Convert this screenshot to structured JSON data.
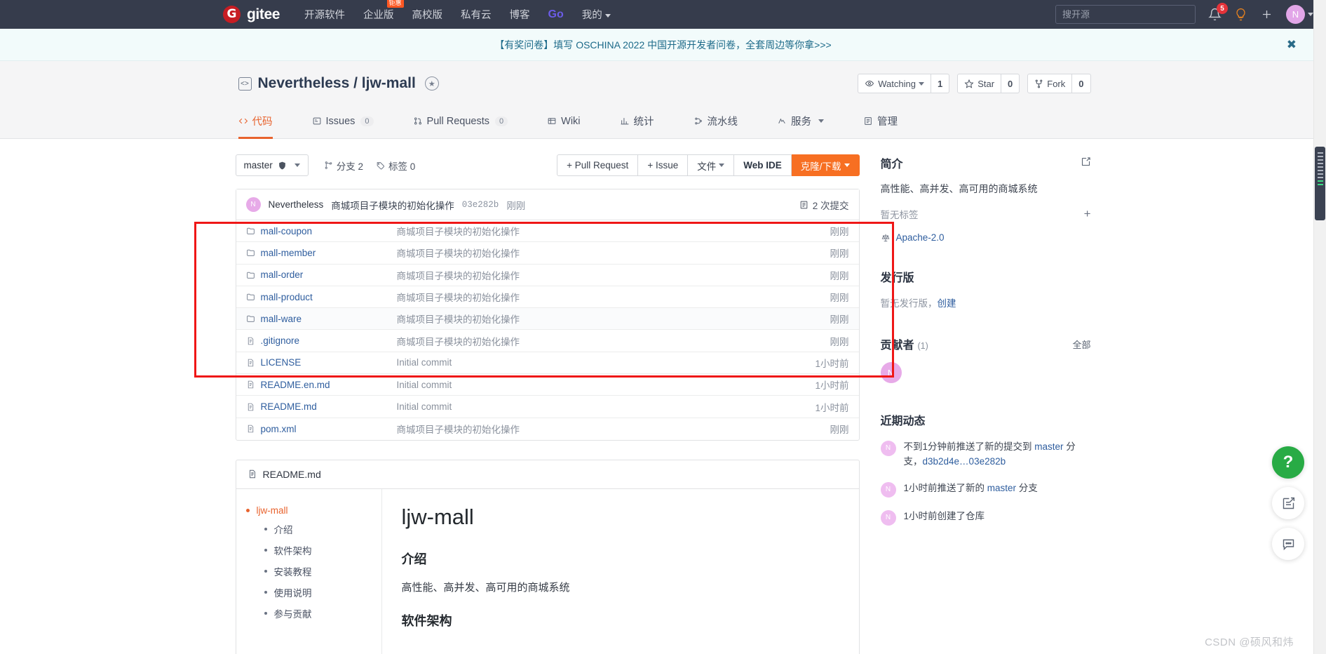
{
  "topnav": {
    "logo_text": "gitee",
    "logo_glyph": "G",
    "items": [
      {
        "label": "开源软件",
        "badge": ""
      },
      {
        "label": "企业版",
        "badge": "钜惠"
      },
      {
        "label": "高校版",
        "badge": ""
      },
      {
        "label": "私有云",
        "badge": ""
      },
      {
        "label": "博客",
        "badge": ""
      },
      {
        "label": "Go",
        "badge": ""
      },
      {
        "label": "我的",
        "badge": ""
      }
    ],
    "search_placeholder": "搜开源",
    "notification_count": "5",
    "avatar_letter": "N"
  },
  "banner": {
    "text": "【有奖问卷】填写 OSCHINA 2022 中国开源开发者问卷，全套周边等你拿>>>",
    "close_glyph": "✖"
  },
  "repo": {
    "owner": "Nevertheless",
    "separator": "/",
    "name": "ljw-mall",
    "watch_label": "Watching",
    "watch_count": "1",
    "star_label": "Star",
    "star_count": "0",
    "fork_label": "Fork",
    "fork_count": "0"
  },
  "tabs": [
    {
      "label": "代码",
      "count": "",
      "active": true
    },
    {
      "label": "Issues",
      "count": "0",
      "active": false
    },
    {
      "label": "Pull Requests",
      "count": "0",
      "active": false
    },
    {
      "label": "Wiki",
      "count": "",
      "active": false
    },
    {
      "label": "统计",
      "count": "",
      "active": false
    },
    {
      "label": "流水线",
      "count": "",
      "active": false
    },
    {
      "label": "服务",
      "count": "",
      "active": false
    },
    {
      "label": "管理",
      "count": "",
      "active": false
    }
  ],
  "toolbar": {
    "branch": "master",
    "branches_label": "分支 2",
    "tags_label": "标签 0",
    "pull_request_label": "+ Pull Request",
    "issue_label": "+ Issue",
    "files_label": "文件",
    "webide_label": "Web IDE",
    "clone_label": "克隆/下载"
  },
  "commit_bar": {
    "avatar_letter": "N",
    "author": "Nevertheless",
    "message": "商城项目子模块的初始化操作",
    "sha": "03e282b",
    "time": "刚刚",
    "commit_count": "2 次提交"
  },
  "files": [
    {
      "name": "mall-coupon",
      "type": "dir",
      "message": "商城项目子模块的初始化操作",
      "time": "刚刚"
    },
    {
      "name": "mall-member",
      "type": "dir",
      "message": "商城项目子模块的初始化操作",
      "time": "刚刚"
    },
    {
      "name": "mall-order",
      "type": "dir",
      "message": "商城项目子模块的初始化操作",
      "time": "刚刚"
    },
    {
      "name": "mall-product",
      "type": "dir",
      "message": "商城项目子模块的初始化操作",
      "time": "刚刚"
    },
    {
      "name": "mall-ware",
      "type": "dir",
      "message": "商城项目子模块的初始化操作",
      "time": "刚刚"
    },
    {
      "name": ".gitignore",
      "type": "file",
      "message": "商城项目子模块的初始化操作",
      "time": "刚刚"
    },
    {
      "name": "LICENSE",
      "type": "file",
      "message": "Initial commit",
      "time": "1小时前"
    },
    {
      "name": "README.en.md",
      "type": "file",
      "message": "Initial commit",
      "time": "1小时前"
    },
    {
      "name": "README.md",
      "type": "file",
      "message": "Initial commit",
      "time": "1小时前"
    },
    {
      "name": "pom.xml",
      "type": "file",
      "message": "商城项目子模块的初始化操作",
      "time": "刚刚"
    }
  ],
  "readme": {
    "filename": "README.md",
    "toc": [
      "ljw-mall",
      "介绍",
      "软件架构",
      "安装教程",
      "使用说明",
      "参与贡献"
    ],
    "h1": "ljw-mall",
    "section1_title": "介绍",
    "section1_text": "高性能、高并发、高可用的商城系统",
    "section2_title": "软件架构"
  },
  "sidebar": {
    "intro_title": "简介",
    "intro_text": "高性能、高并发、高可用的商城系统",
    "no_tags": "暂无标签",
    "license": "Apache-2.0",
    "releases_title": "发行版",
    "no_releases": "暂无发行版，",
    "create_link": "创建",
    "contributors_title": "贡献者",
    "contributors_count": "(1)",
    "contributors_all": "全部",
    "contributor_letter": "N",
    "activity_title": "近期动态",
    "activities": [
      {
        "avatar": "N",
        "pre": "不到1分钟前推送了新的提交到 ",
        "link1": "master",
        "mid": " 分支，",
        "link2": "d3b2d4e…03e282b",
        "post": ""
      },
      {
        "avatar": "N",
        "pre": "1小时前推送了新的 ",
        "link1": "master",
        "mid": " 分支",
        "link2": "",
        "post": ""
      },
      {
        "avatar": "N",
        "pre": "1小时前创建了仓库",
        "link1": "",
        "mid": "",
        "link2": "",
        "post": ""
      }
    ]
  },
  "fabs": [
    {
      "name": "help",
      "glyph": "?"
    },
    {
      "name": "feedback",
      "glyph": "✎"
    },
    {
      "name": "chat",
      "glyph": "▭"
    }
  ],
  "watermark": "CSDN @硕风和炜"
}
